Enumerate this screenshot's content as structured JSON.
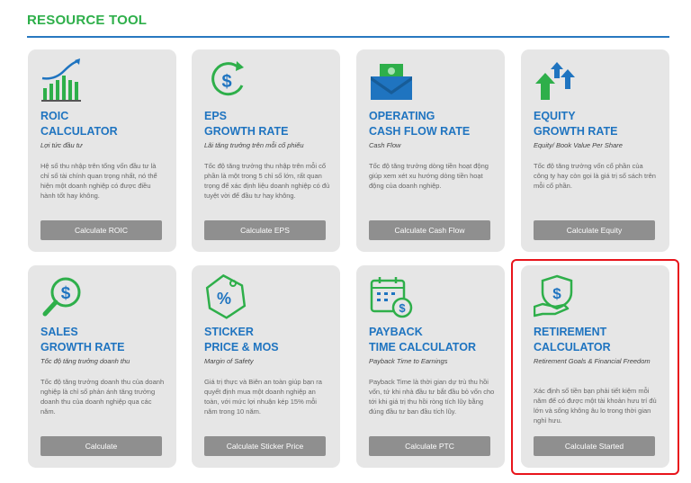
{
  "header": {
    "title": "RESOURCE TOOL"
  },
  "cards": [
    {
      "title_line1": "ROIC",
      "title_line2": "CALCULATOR",
      "subtitle": "Lợi tức đầu tư",
      "description": "Hệ số thu nhập trên tổng vốn đầu tư là chỉ số tài chính quan trọng nhất, nó thể hiện một doanh nghiệp có được điều hành tốt hay không.",
      "button": "Calculate ROIC",
      "icon": "growth-chart-icon"
    },
    {
      "title_line1": "EPS",
      "title_line2": "GROWTH RATE",
      "subtitle": "Lãi tăng trưởng trên mỗi cổ phiếu",
      "description": "Tốc độ tăng trưởng thu nhập trên mỗi cổ phần là một trong 5 chỉ số lớn, rất quan trọng để xác định liệu doanh nghiệp có đủ tuyệt vời để đầu tư hay không.",
      "button": "Calculate EPS",
      "icon": "dollar-cycle-icon"
    },
    {
      "title_line1": "OPERATING",
      "title_line2": "CASH FLOW RATE",
      "subtitle": "Cash Flow",
      "description": "Tốc độ tăng trưởng dòng tiền hoạt động giúp xem xét xu hướng dòng tiền hoạt động của doanh nghiệp.",
      "button": "Calculate Cash Flow",
      "icon": "cash-envelope-icon"
    },
    {
      "title_line1": "EQUITY",
      "title_line2": "GROWTH RATE",
      "subtitle": "Equity/ Book Value Per Share",
      "description": "Tốc độ tăng trưởng vốn cổ phần của công ty hay còn gọi là giá trị số sách trên mỗi cổ phần.",
      "button": "Calculate Equity",
      "icon": "arrows-up-icon"
    },
    {
      "title_line1": "SALES",
      "title_line2": "GROWTH RATE",
      "subtitle": "Tốc độ tăng trưởng doanh thu",
      "description": "Tốc độ tăng trưởng doanh thu của doanh nghiệp là chỉ số phản ánh tăng trưởng doanh thu của doanh nghiệp qua các năm.",
      "button": "Calculate",
      "icon": "dollar-magnifier-icon"
    },
    {
      "title_line1": "STICKER",
      "title_line2": "PRICE & MOS",
      "subtitle": "Margin of Safety",
      "description": "Giá trị thực và Biên an toàn giúp bạn ra quyết định mua một doanh nghiệp an toàn, với mức lợi nhuận kép 15% mỗi năm trong 10 năm.",
      "button": "Calculate Sticker Price",
      "icon": "percent-tag-icon"
    },
    {
      "title_line1": "PAYBACK",
      "title_line2": "TIME CALCULATOR",
      "subtitle": "Payback Time to Earnings",
      "description": "Payback Time là thời gian dự trù thu hồi vốn, tứ khi nhà đầu tư bắt đầu bỏ vốn cho tới khi giá trị thu hồi ròng tích lũy bằng đúng đầu tư ban đầu tích lũy.",
      "button": "Calculate PTC",
      "icon": "calendar-dollar-icon"
    },
    {
      "title_line1": "RETIREMENT",
      "title_line2": "CALCULATOR",
      "subtitle": "Retirement Goals & Financial Freedom",
      "description": "Xác định số tiền bạn phải tiết kiệm mỗi năm để có được một tài khoản hưu trí đủ lớn và sống không âu lo trong thời gian nghỉ hưu.",
      "button": "Calculate Started",
      "icon": "hand-shield-dollar-icon"
    }
  ],
  "colors": {
    "header_green": "#2eaf4a",
    "title_blue": "#1f74c0",
    "rule_blue": "#2878c0",
    "card_bg": "#e6e6e6",
    "button_gray": "#8f8f8f",
    "highlight_red": "#e8141b"
  }
}
